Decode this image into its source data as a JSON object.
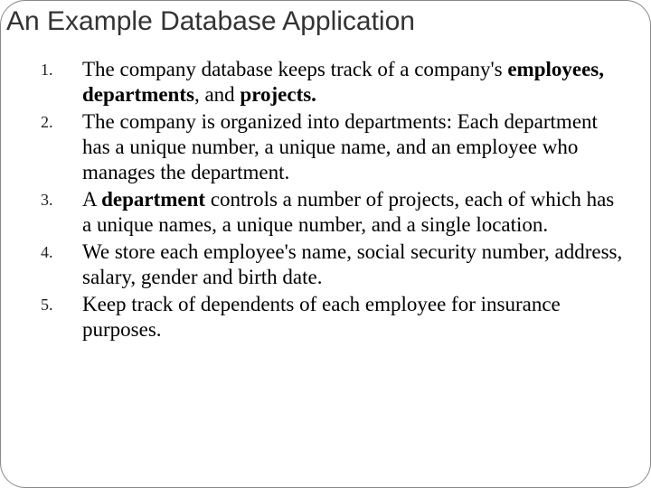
{
  "title": "An Example Database Application",
  "items": [
    {
      "num": "1.",
      "prefix": "The company database keeps track of a company's ",
      "bold": "employees, departments",
      "mid": ", and ",
      "bold2": "projects.",
      "suffix": ""
    },
    {
      "num": "2.",
      "prefix": "The company is organized into departments: Each department has a unique number, a unique name, and an employee who manages the department.",
      "bold": "",
      "mid": "",
      "bold2": "",
      "suffix": ""
    },
    {
      "num": "3.",
      "prefix": "A ",
      "bold": "department",
      "mid": " controls a number of projects, each of which has a unique names, a unique number, and a single location.",
      "bold2": "",
      "suffix": ""
    },
    {
      "num": "4.",
      "prefix": "We store each employee's name, social security number, address, salary, gender and birth date.",
      "bold": "",
      "mid": "",
      "bold2": "",
      "suffix": ""
    },
    {
      "num": "5.",
      "prefix": "Keep track of dependents of each employee for insurance purposes.",
      "bold": "",
      "mid": "",
      "bold2": "",
      "suffix": ""
    }
  ]
}
